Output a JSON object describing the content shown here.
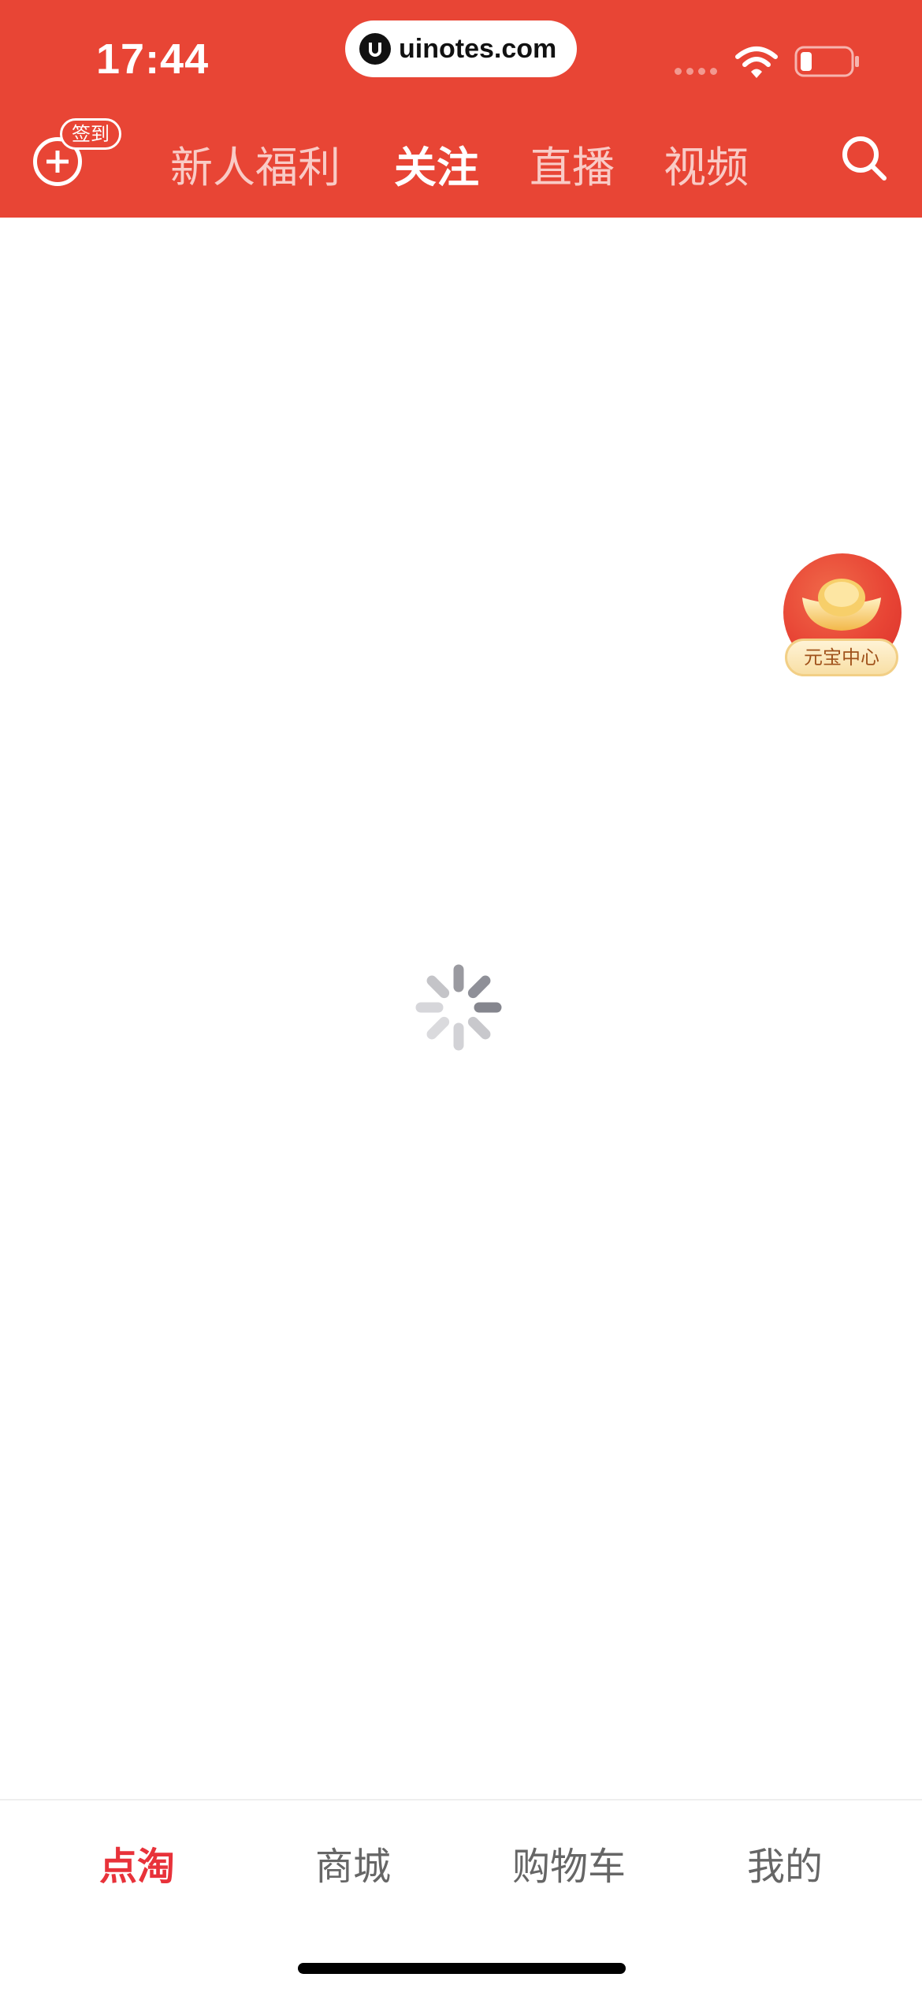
{
  "status_bar": {
    "time": "17:44",
    "url": "uinotes.com"
  },
  "header": {
    "checkin_label": "签到",
    "tabs": [
      {
        "label": "新人福利",
        "active": false
      },
      {
        "label": "关注",
        "active": true
      },
      {
        "label": "直播",
        "active": false
      },
      {
        "label": "视频",
        "active": false
      }
    ],
    "search_icon": "search-icon"
  },
  "floating": {
    "reward_label": "元宝中心"
  },
  "bottom_tabs": [
    {
      "label": "点淘",
      "active": true
    },
    {
      "label": "商城",
      "active": false
    },
    {
      "label": "购物车",
      "active": false
    },
    {
      "label": "我的",
      "active": false
    }
  ],
  "colors": {
    "header_bg": "#e84535",
    "active_tab": "#e8323a",
    "inactive_tab": "#666666"
  }
}
